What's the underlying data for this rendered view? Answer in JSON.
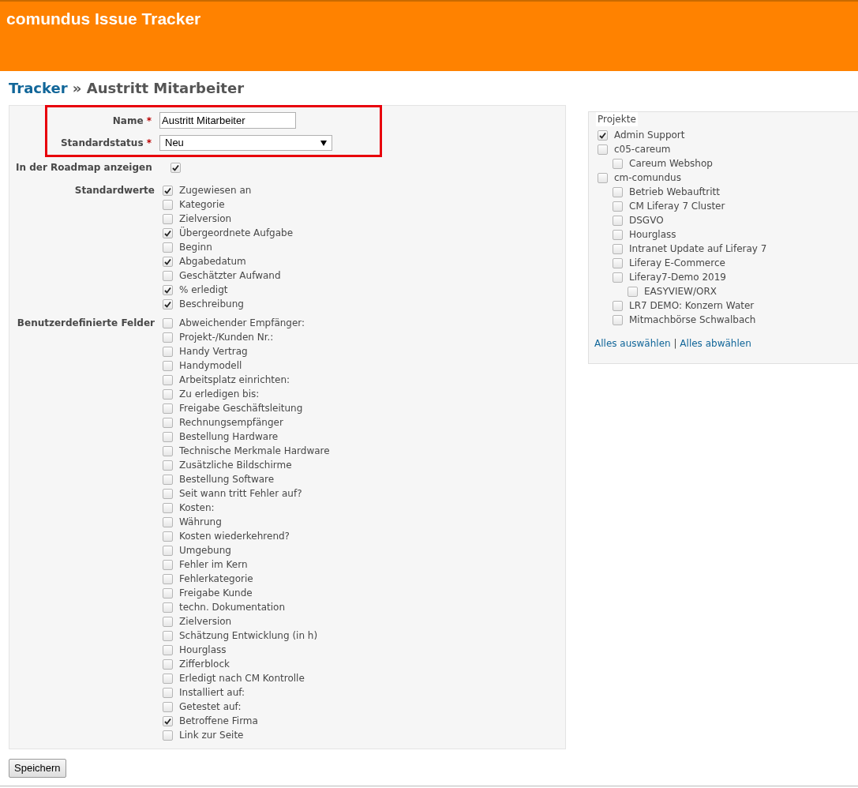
{
  "header": {
    "title": "comundus Issue Tracker"
  },
  "breadcrumb": {
    "link": "Tracker",
    "separator": "»",
    "current": "Austritt Mitarbeiter"
  },
  "form": {
    "name": {
      "label": "Name",
      "required_mark": "*",
      "value": "Austritt Mitarbeiter"
    },
    "status": {
      "label": "Standardstatus",
      "required_mark": "*",
      "value": "Neu"
    },
    "roadmap": {
      "label": "In der Roadmap anzeigen",
      "checked": true
    },
    "standard_fields": {
      "label": "Standardwerte",
      "items": [
        {
          "label": "Zugewiesen an",
          "checked": true
        },
        {
          "label": "Kategorie",
          "checked": false
        },
        {
          "label": "Zielversion",
          "checked": false
        },
        {
          "label": "Übergeordnete Aufgabe",
          "checked": true
        },
        {
          "label": "Beginn",
          "checked": false
        },
        {
          "label": "Abgabedatum",
          "checked": true
        },
        {
          "label": "Geschätzter Aufwand",
          "checked": false
        },
        {
          "label": "% erledigt",
          "checked": true
        },
        {
          "label": "Beschreibung",
          "checked": true
        }
      ]
    },
    "custom_fields": {
      "label": "Benutzerdefinierte Felder",
      "items": [
        {
          "label": "Abweichender Empfänger:",
          "checked": false
        },
        {
          "label": "Projekt-/Kunden Nr.:",
          "checked": false
        },
        {
          "label": "Handy Vertrag",
          "checked": false
        },
        {
          "label": "Handymodell",
          "checked": false
        },
        {
          "label": "Arbeitsplatz einrichten:",
          "checked": false
        },
        {
          "label": "Zu erledigen bis:",
          "checked": false
        },
        {
          "label": "Freigabe Geschäftsleitung",
          "checked": false
        },
        {
          "label": "Rechnungsempfänger",
          "checked": false
        },
        {
          "label": "Bestellung Hardware",
          "checked": false
        },
        {
          "label": "Technische Merkmale Hardware",
          "checked": false
        },
        {
          "label": "Zusätzliche Bildschirme",
          "checked": false
        },
        {
          "label": "Bestellung Software",
          "checked": false
        },
        {
          "label": "Seit wann tritt Fehler auf?",
          "checked": false
        },
        {
          "label": "Kosten:",
          "checked": false
        },
        {
          "label": "Währung",
          "checked": false
        },
        {
          "label": "Kosten wiederkehrend?",
          "checked": false
        },
        {
          "label": "Umgebung",
          "checked": false
        },
        {
          "label": "Fehler im Kern",
          "checked": false
        },
        {
          "label": "Fehlerkategorie",
          "checked": false
        },
        {
          "label": "Freigabe Kunde",
          "checked": false
        },
        {
          "label": "techn. Dokumentation",
          "checked": false
        },
        {
          "label": "Zielversion",
          "checked": false
        },
        {
          "label": "Schätzung Entwicklung (in h)",
          "checked": false
        },
        {
          "label": "Hourglass",
          "checked": false
        },
        {
          "label": "Zifferblock",
          "checked": false
        },
        {
          "label": "Erledigt nach CM Kontrolle",
          "checked": false
        },
        {
          "label": "Installiert auf:",
          "checked": false
        },
        {
          "label": "Getestet auf:",
          "checked": false
        },
        {
          "label": "Betroffene Firma",
          "checked": true
        },
        {
          "label": "Link zur Seite",
          "checked": false
        }
      ]
    }
  },
  "projects": {
    "legend": "Projekte",
    "items": [
      {
        "label": "Admin Support",
        "checked": true
      },
      {
        "label": "c05-careum",
        "checked": false,
        "children": [
          {
            "label": "Careum Webshop",
            "checked": false
          }
        ]
      },
      {
        "label": "cm-comundus",
        "checked": false,
        "children": [
          {
            "label": "Betrieb Webauftritt",
            "checked": false
          },
          {
            "label": "CM Liferay 7 Cluster",
            "checked": false
          },
          {
            "label": "DSGVO",
            "checked": false
          },
          {
            "label": "Hourglass",
            "checked": false
          },
          {
            "label": "Intranet Update auf Liferay 7",
            "checked": false
          },
          {
            "label": "Liferay E-Commerce",
            "checked": false
          },
          {
            "label": "Liferay7-Demo 2019",
            "checked": false,
            "children": [
              {
                "label": "EASYVIEW/ORX",
                "checked": false
              }
            ]
          },
          {
            "label": "LR7 DEMO: Konzern Water",
            "checked": false
          },
          {
            "label": "Mitmachbörse Schwalbach",
            "checked": false
          }
        ]
      }
    ],
    "links": [
      "Alles auswählen",
      "Alles abwählen"
    ],
    "link_separator": "|"
  },
  "save_button": "Speichern"
}
